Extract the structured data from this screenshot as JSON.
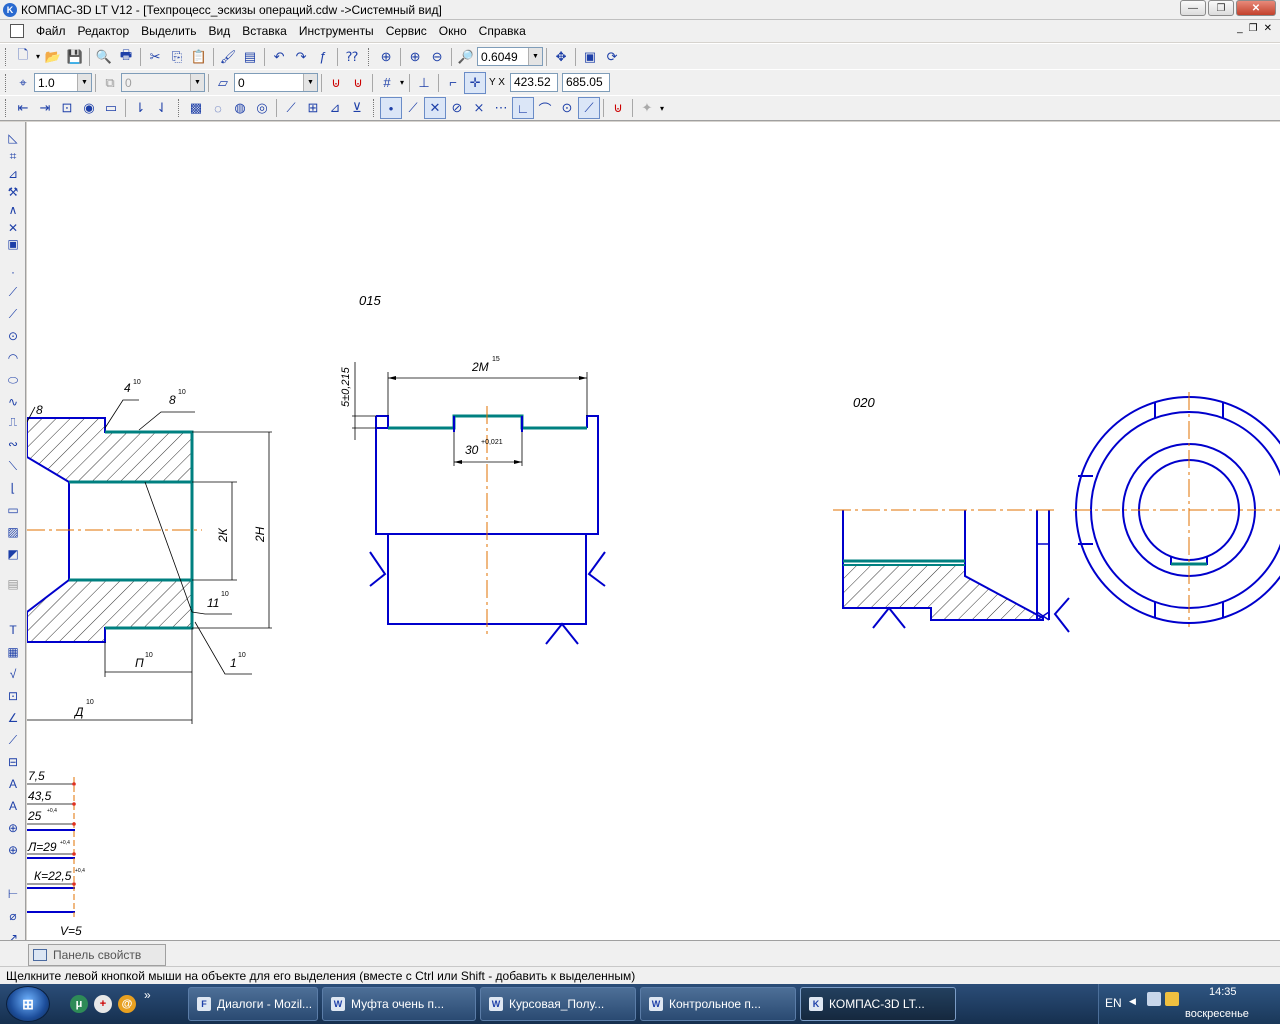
{
  "window": {
    "title": "КОМПАС-3D LT V12 - [Техпроцесс_эскизы операций.cdw ->Системный вид]",
    "app_icon_letter": "K",
    "minimize": "—",
    "restore": "❐",
    "close": "✕"
  },
  "menu": {
    "items": [
      "Файл",
      "Редактор",
      "Выделить",
      "Вид",
      "Вставка",
      "Инструменты",
      "Сервис",
      "Окно",
      "Справка"
    ],
    "mdi_minimize": "_",
    "mdi_restore": "❐",
    "mdi_close": "✕"
  },
  "toolbar1": {
    "zoom_value": "0.6049"
  },
  "toolbar2": {
    "step_value": "1.0",
    "angle_value": "0",
    "layer_value": "0",
    "coord_label": "Y X",
    "x_value": "423.52",
    "y_value": "685.05"
  },
  "drawing": {
    "op_015_label": "015",
    "op_020_label": "020",
    "dim_2M": "2М",
    "dim_2M_tol": "15",
    "dim_30": "30",
    "dim_30_tol": "+0,021",
    "dim_5": "5±0,215",
    "dim_4": "4",
    "dim_8": "8",
    "dim_2K": "2К",
    "dim_2H": "2Н",
    "dim_11": "11",
    "dim_1": "1",
    "dim_P": "П",
    "dim_D": "Д",
    "sup_10": "10",
    "tbl_1": "7,5",
    "tbl_2": "43,5",
    "tbl_3": "25",
    "tbl_4": "Л=29",
    "tbl_5": "К=22,5",
    "tbl_6": "V=5",
    "tbl_small": "+0,4",
    "partial_8": "8"
  },
  "props_panel": {
    "tab_label": "Панель свойств"
  },
  "status": {
    "text": "Щелкните левой кнопкой мыши на объекте для его выделения (вместе с Ctrl или Shift - добавить к выделенным)"
  },
  "taskbar": {
    "start_label": "⊞",
    "chevron": "»",
    "tasks": [
      {
        "label": "Диалоги - Mozil...",
        "icon": "F"
      },
      {
        "label": "Муфта очень п...",
        "icon": "W"
      },
      {
        "label": "Курсовая_Полу...",
        "icon": "W"
      },
      {
        "label": "Контрольное п...",
        "icon": "W"
      },
      {
        "label": "КОМПАС-3D LT...",
        "icon": "K"
      }
    ],
    "lang": "EN",
    "time": "14:35",
    "day": "воскресенье"
  },
  "colors": {
    "line_blue": "#0000cc",
    "teal": "#008080",
    "axis_orange": "#e07000",
    "thin_black": "#000000"
  }
}
